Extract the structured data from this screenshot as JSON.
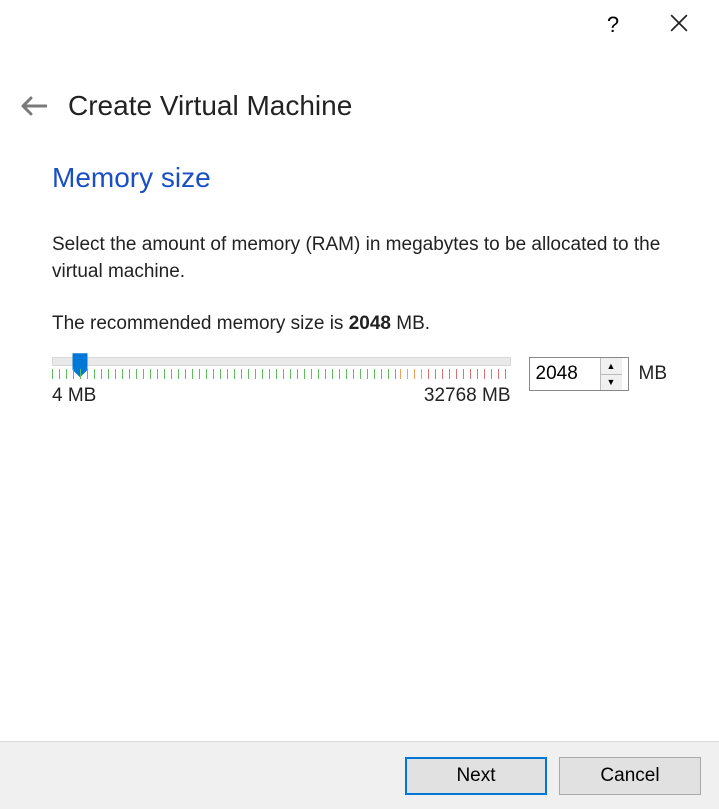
{
  "titlebar": {
    "help_label": "?",
    "close_label": "Close"
  },
  "header": {
    "title": "Create Virtual Machine"
  },
  "step": {
    "title": "Memory size",
    "description": "Select the amount of memory (RAM) in megabytes to be allocated to the virtual machine.",
    "recommend_prefix": "The recommended memory size is ",
    "recommend_value": "2048",
    "recommend_suffix": " MB."
  },
  "slider": {
    "min_label": "4 MB",
    "max_label": "32768 MB",
    "value": "2048",
    "unit": "MB"
  },
  "footer": {
    "next_label": "Next",
    "cancel_label": "Cancel"
  }
}
